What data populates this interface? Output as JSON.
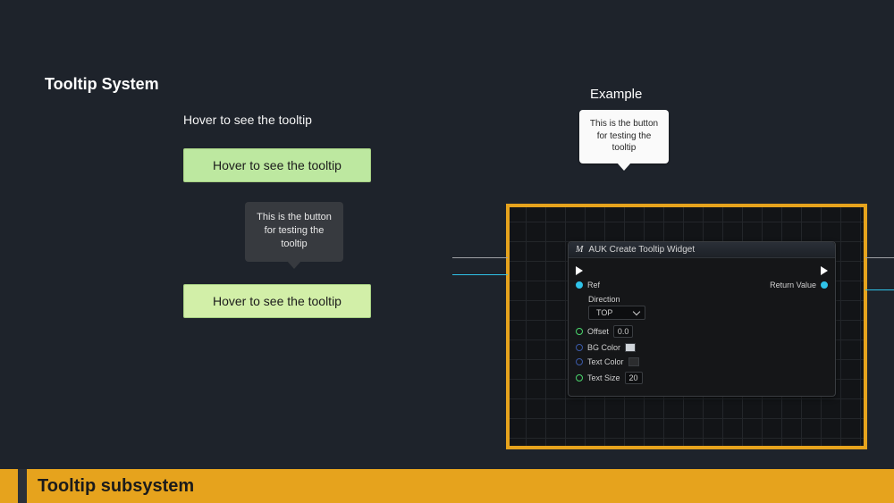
{
  "heading": "Tooltip System",
  "plain_text_demo": "Hover to see the tooltip",
  "hover_button_label": "Hover to see the tooltip",
  "tooltip_body": "This is the button for testing the tooltip",
  "example_label": "Example",
  "blueprint": {
    "node_title": "AUK Create Tooltip Widget",
    "pins": {
      "ref": "Ref",
      "direction_label": "Direction",
      "direction_value": "TOP",
      "offset_label": "Offset",
      "offset_value": "0.0",
      "bg_color_label": "BG Color",
      "text_color_label": "Text Color",
      "text_size_label": "Text Size",
      "text_size_value": "20",
      "return_value": "Return Value"
    }
  },
  "footer": "Tooltip subsystem"
}
